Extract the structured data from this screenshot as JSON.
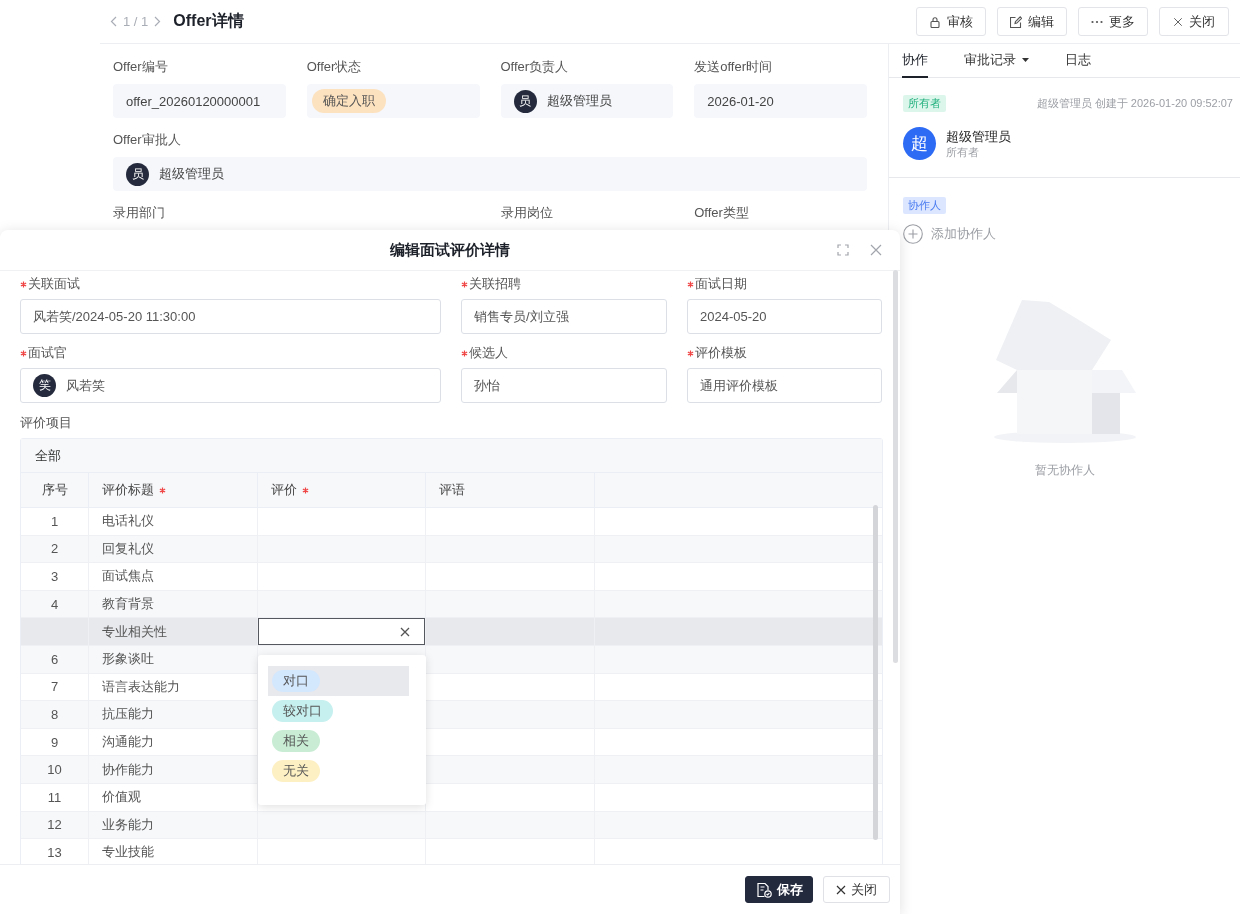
{
  "header": {
    "pager": "1 / 1",
    "title": "Offer详情",
    "actions": [
      {
        "label": "审核"
      },
      {
        "label": "编辑"
      },
      {
        "label": "更多"
      },
      {
        "label": "关闭"
      }
    ]
  },
  "offer": {
    "rows": [
      [
        {
          "label": "Offer编号",
          "kind": "text",
          "value": "offer_20260120000001"
        },
        {
          "label": "Offer状态",
          "kind": "tag",
          "value": "确定入职"
        },
        {
          "label": "Offer负责人",
          "kind": "user",
          "avatar": "员",
          "value": "超级管理员"
        },
        {
          "label": "发送offer时间",
          "kind": "text",
          "value": "2026-01-20"
        }
      ],
      [
        {
          "label": "Offer审批人",
          "kind": "user",
          "avatar": "员",
          "value": "超级管理员"
        }
      ],
      [
        {
          "label": "录用部门"
        },
        null,
        {
          "label": "录用岗位"
        },
        {
          "label": "Offer类型"
        }
      ]
    ]
  },
  "collab": {
    "tabs": [
      {
        "label": "协作",
        "selected": true,
        "dropdown": false
      },
      {
        "label": "审批记录",
        "selected": false,
        "dropdown": true
      },
      {
        "label": "日志",
        "selected": false,
        "dropdown": false
      }
    ],
    "owner": {
      "tag": "所有者",
      "meta": "超级管理员 创建于 2026-01-20 09:52:07",
      "avatar": "超",
      "name": "超级管理员",
      "role": "所有者"
    },
    "collaborators": {
      "tag": "协作人",
      "add": "添加协作人",
      "empty": "暂无协作人"
    }
  },
  "modal": {
    "title": "编辑面试评价详情",
    "fields": [
      {
        "label": "关联面试",
        "required": true,
        "value": "风若笑/2024-05-20 11:30:00"
      },
      {
        "label": "关联招聘",
        "required": true,
        "value": "销售专员/刘立强"
      },
      {
        "label": "面试日期",
        "required": true,
        "value": "2024-05-20"
      },
      {
        "label": "面试官",
        "required": true,
        "avatar": "笑",
        "value": "风若笑"
      },
      {
        "label": "候选人",
        "required": true,
        "value": "孙怡"
      },
      {
        "label": "评价模板",
        "required": true,
        "value": "通用评价模板"
      }
    ],
    "section_label": "评价项目",
    "table": {
      "group": "全部",
      "columns": [
        {
          "label": "序号",
          "required": false
        },
        {
          "label": "评价标题",
          "required": true
        },
        {
          "label": "评价",
          "required": true
        },
        {
          "label": "评语",
          "required": false
        }
      ],
      "rows": [
        {
          "index": "1",
          "title": "电话礼仪",
          "selected": false
        },
        {
          "index": "2",
          "title": "回复礼仪",
          "selected": false
        },
        {
          "index": "3",
          "title": "面试焦点",
          "selected": false
        },
        {
          "index": "4",
          "title": "教育背景",
          "selected": false
        },
        {
          "title": "专业相关性",
          "selected": true
        },
        {
          "index": "6",
          "title": "形象谈吐",
          "selected": false
        },
        {
          "index": "7",
          "title": "语言表达能力",
          "selected": false
        },
        {
          "index": "8",
          "title": "抗压能力",
          "selected": false
        },
        {
          "index": "9",
          "title": "沟通能力",
          "selected": false
        },
        {
          "index": "10",
          "title": "协作能力",
          "selected": false
        },
        {
          "index": "11",
          "title": "价值观",
          "selected": false
        },
        {
          "index": "12",
          "title": "业务能力",
          "selected": false
        },
        {
          "index": "13",
          "title": "专业技能",
          "selected": false
        }
      ],
      "editor_options": [
        {
          "label": "对口",
          "color": "#d3e7fd",
          "selected": true
        },
        {
          "label": "较对口",
          "color": "#c6f0ef",
          "selected": false
        },
        {
          "label": "相关",
          "color": "#c8edd4",
          "selected": false
        },
        {
          "label": "无关",
          "color": "#fdf0c3",
          "selected": false
        }
      ]
    },
    "buttons": [
      {
        "label": "保存",
        "kind": "primary"
      },
      {
        "label": "关闭",
        "kind": "default"
      }
    ]
  }
}
